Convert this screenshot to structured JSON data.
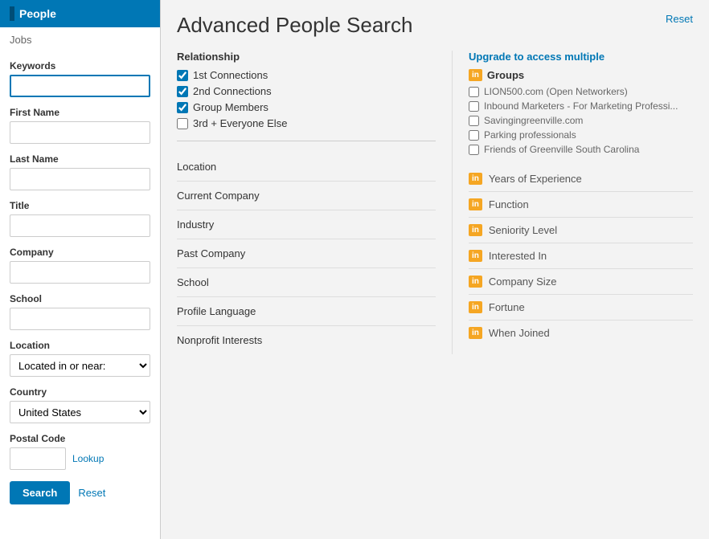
{
  "sidebar": {
    "people_label": "People",
    "jobs_label": "Jobs",
    "keywords_label": "Keywords",
    "keywords_placeholder": "",
    "first_name_label": "First Name",
    "last_name_label": "Last Name",
    "title_label": "Title",
    "company_label": "Company",
    "school_label": "School",
    "location_label": "Location",
    "location_option": "Located in or near:",
    "country_label": "Country",
    "country_value": "United States",
    "postal_code_label": "Postal Code",
    "lookup_label": "Lookup",
    "search_button": "Search",
    "reset_label": "Reset"
  },
  "main": {
    "title": "Advanced People Search",
    "reset_label": "Reset"
  },
  "relationship": {
    "label": "Relationship",
    "options": [
      {
        "label": "1st Connections",
        "checked": true
      },
      {
        "label": "2nd Connections",
        "checked": true
      },
      {
        "label": "Group Members",
        "checked": true
      },
      {
        "label": "3rd + Everyone Else",
        "checked": false
      }
    ]
  },
  "fields_left": [
    {
      "name": "Location"
    },
    {
      "name": "Current Company"
    },
    {
      "name": "Industry"
    },
    {
      "name": "Past Company"
    },
    {
      "name": "School"
    },
    {
      "name": "Profile Language"
    },
    {
      "name": "Nonprofit Interests"
    }
  ],
  "right_col": {
    "upgrade_label": "Upgrade to access multiple",
    "groups_label": "Groups",
    "group_items": [
      {
        "label": "LION500.com (Open Networkers)",
        "checked": false
      },
      {
        "label": "Inbound Marketers - For Marketing Professi...",
        "checked": false
      },
      {
        "label": "Savingingreenville.com",
        "checked": false
      },
      {
        "label": "Parking professionals",
        "checked": false
      },
      {
        "label": "Friends of Greenville South Carolina",
        "checked": false
      }
    ],
    "premium_items": [
      {
        "label": "Years of Experience"
      },
      {
        "label": "Function"
      },
      {
        "label": "Seniority Level"
      },
      {
        "label": "Interested In"
      },
      {
        "label": "Company Size"
      },
      {
        "label": "Fortune"
      },
      {
        "label": "When Joined"
      }
    ]
  }
}
